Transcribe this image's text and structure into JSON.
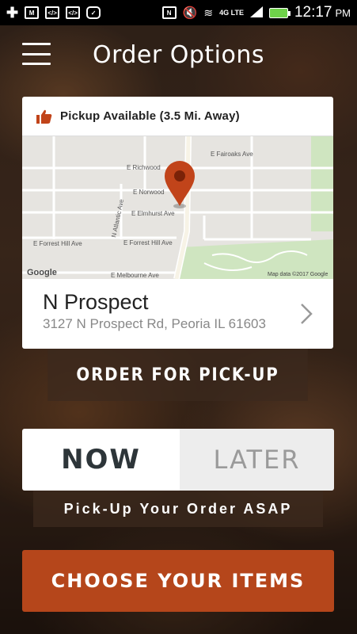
{
  "status_bar": {
    "time": "12:17",
    "ampm": "PM",
    "network": "4G LTE",
    "battery_color": "#6fd24a"
  },
  "header": {
    "title": "Order Options",
    "menu_icon": "hamburger-menu-icon"
  },
  "location": {
    "pickup_icon": "thumbs-up-icon",
    "pickup_text": "Pickup Available (3.5 Mi. Away)",
    "store_name": "N Prospect",
    "store_address": "3127 N Prospect Rd, Peoria IL 61603",
    "map": {
      "streets": {
        "fairoaks": "E Fairoaks Ave",
        "richwood": "E Richwood",
        "norwood": "E Norwood",
        "atlantic": "N Atlantic Ave",
        "elmhurst": "E Elmhurst Ave",
        "forrest_left": "E Forrest Hill Ave",
        "forrest_mid": "E Forrest Hill Ave",
        "melbourne": "E Melbourne Ave"
      },
      "logo": "Google",
      "attribution": "Map data ©2017 Google",
      "pin_color": "#c1441a"
    }
  },
  "actions": {
    "order_pickup": "ORDER FOR PICK-UP",
    "now": "NOW",
    "later": "LATER",
    "asap_note": "Pick-Up Your Order ASAP",
    "choose_items": "CHOOSE YOUR ITEMS"
  },
  "colors": {
    "accent": "#b5461b"
  }
}
